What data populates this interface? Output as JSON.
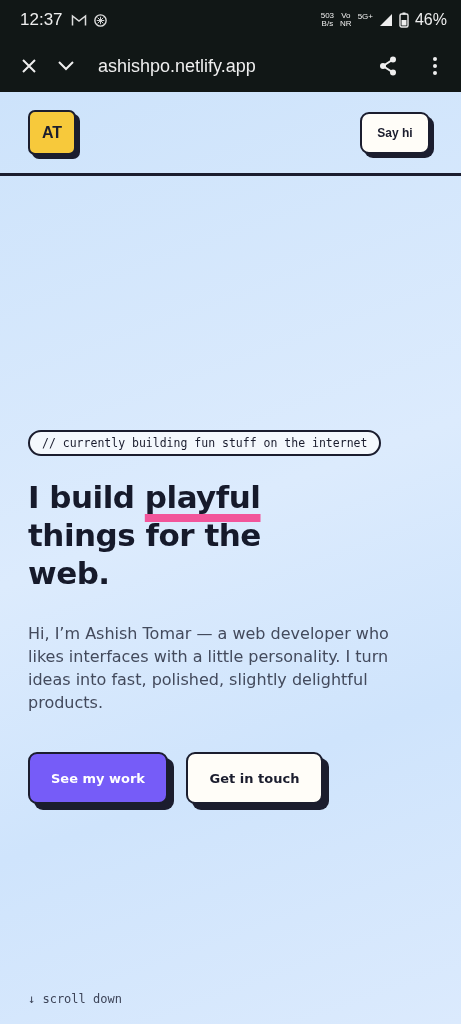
{
  "status_bar": {
    "time": "12:37",
    "net_speed": "503",
    "net_unit": "B/s",
    "voice_top": "Vo",
    "voice_bottom": "NR",
    "network": "5G+",
    "battery": "46%"
  },
  "browser_bar": {
    "url": "ashishpo.netlify.app"
  },
  "header": {
    "logo": "AT",
    "cta": "Say hi"
  },
  "hero": {
    "tag": "// currently building fun stuff on the internet",
    "heading": {
      "before": "I build ",
      "highlight": "playful",
      "after": " things for the web."
    },
    "intro": "Hi, I’m Ashish Tomar — a web developer who likes interfaces with a little personality. I turn ideas into fast, polished, slightly delightful products.",
    "buttons": [
      {
        "label": "See my work",
        "kind": "primary"
      },
      {
        "label": "Get in touch",
        "kind": "secondary"
      }
    ],
    "scroll_hint": "↓ scroll down"
  }
}
